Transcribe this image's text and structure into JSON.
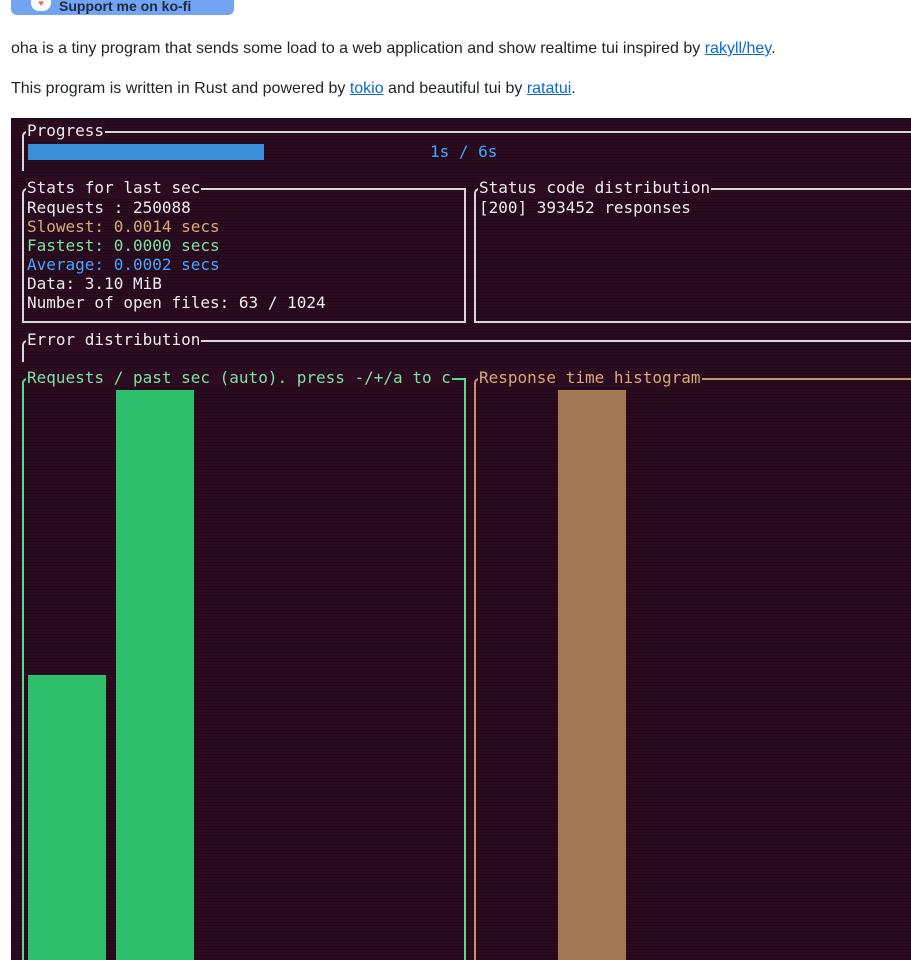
{
  "kofi": {
    "label": "Support me on ko-fi",
    "icon": "kofi-cup-icon"
  },
  "intro": {
    "text_before": "oha is a tiny program that sends some load to a web application and show realtime tui inspired by ",
    "link": "rakyll/hey",
    "text_after": "."
  },
  "powered": {
    "text_before": "This program is written in Rust and powered by ",
    "link1": "tokio",
    "text_middle": " and beautiful tui by ",
    "link2": "ratatui",
    "text_after": "."
  },
  "terminal": {
    "progress": {
      "title": "Progress",
      "text": "1s / 6s",
      "fraction": 0.3333
    },
    "stats": {
      "title": "Stats for last sec",
      "requests": "Requests : 250088",
      "slowest": "Slowest: 0.0014 secs",
      "fastest": "Fastest: 0.0000 secs",
      "average": "Average: 0.0002 secs",
      "data": "Data: 3.10 MiB",
      "open_files": "Number of open files: 63 / 1024"
    },
    "status": {
      "title": "Status code distribution",
      "line": "[200] 393452 responses"
    },
    "errors": {
      "title": "Error distribution"
    },
    "requests_chart": {
      "title": "Requests / past sec (auto). press -/+/a to c",
      "bars": [
        0.5,
        1.0
      ],
      "color": "#2ebf6c"
    },
    "histogram": {
      "title": "Response time histogram",
      "bars": [
        1.0
      ],
      "color": "#a37a55"
    },
    "colors": {
      "slowest": "#d9a978",
      "fastest": "#7ee2a0",
      "average": "#45a5ff",
      "background": "#2a0b1f"
    }
  }
}
